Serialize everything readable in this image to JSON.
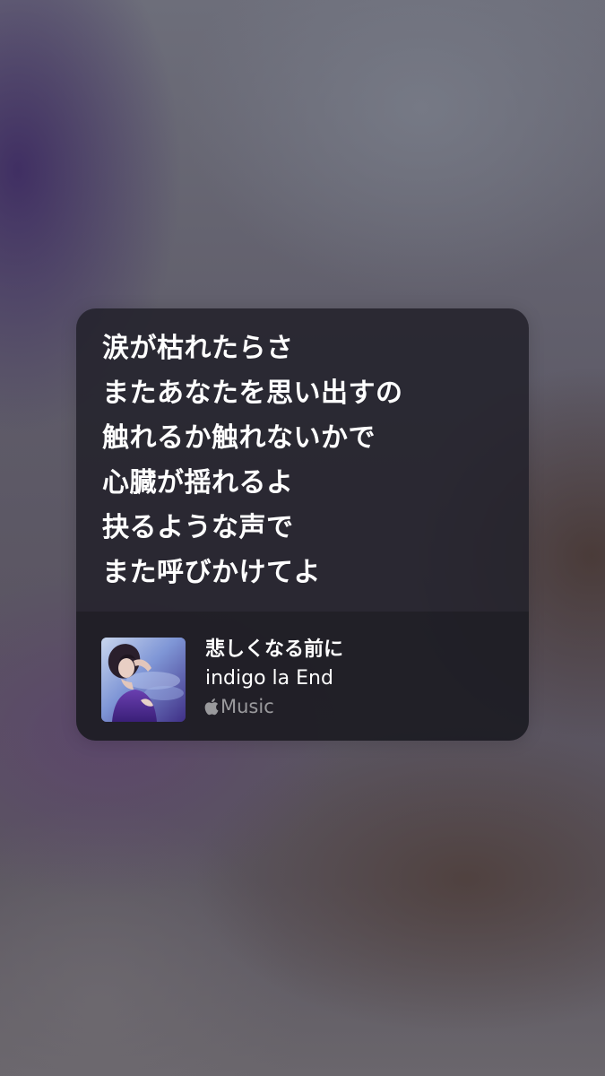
{
  "lyrics": {
    "lines": [
      "涙が枯れたらさ",
      "またあなたを思い出すの",
      "触れるか触れないかで",
      "心臓が揺れるよ",
      "抉るような声で",
      "また呼びかけてよ"
    ]
  },
  "track": {
    "title": "悲しくなる前に",
    "artist": "indigo la End",
    "service_label": "Music",
    "service_icon": "apple-logo-icon",
    "artwork_icon": "album-artwork"
  },
  "colors": {
    "card_bg": "#22212a",
    "text": "#ffffff",
    "muted_text": "#8c8a92"
  }
}
